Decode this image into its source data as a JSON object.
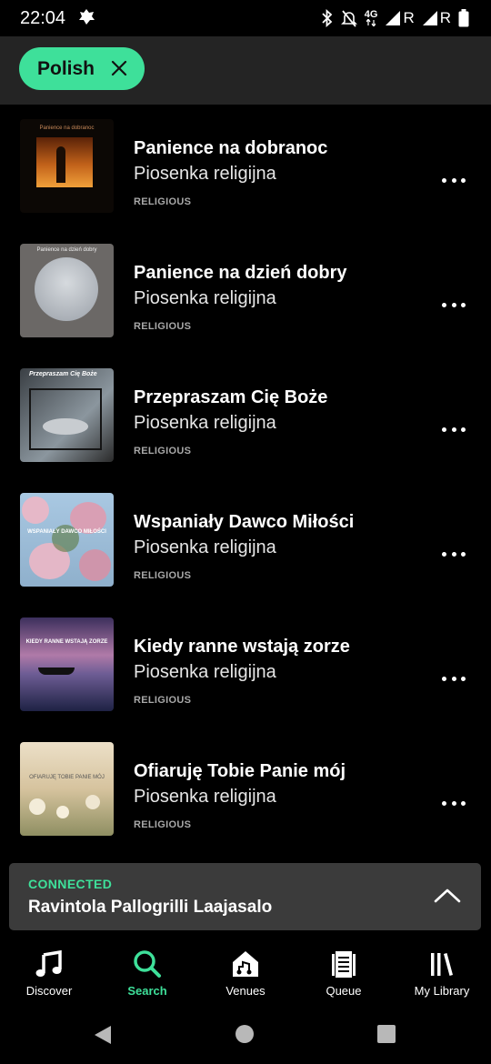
{
  "status_bar": {
    "time": "22:04",
    "network_label": "4G",
    "roaming_1": "R",
    "roaming_2": "R",
    "icons": [
      "notification-app-icon",
      "bluetooth-icon",
      "mute-icon",
      "signal-icon",
      "signal-icon",
      "battery-icon"
    ]
  },
  "filter": {
    "chip_label": "Polish",
    "chip_close_icon": "close-icon"
  },
  "songs": [
    {
      "title": "Panience na dobranoc",
      "artist": "Piosenka religijna",
      "genre": "RELIGIOUS",
      "cover_caption": "Panience na dobranoc",
      "cover_colors": [
        "#1a0d05",
        "#c2621a",
        "#f0a03a"
      ]
    },
    {
      "title": "Panience na dzień dobry",
      "artist": "Piosenka religijna",
      "genre": "RELIGIOUS",
      "cover_caption": "Panience na dzień dobry",
      "cover_colors": [
        "#5e5a58",
        "#b5b8bd",
        "#6b6866"
      ]
    },
    {
      "title": "Przepraszam Cię Boże",
      "artist": "Piosenka religijna",
      "genre": "RELIGIOUS",
      "cover_caption": "Przepraszam Cię Boże",
      "cover_colors": [
        "#1c1c1c",
        "#7b858c",
        "#2e2e2e"
      ]
    },
    {
      "title": "Wspaniały Dawco Miłości",
      "artist": "Piosenka religijna",
      "genre": "RELIGIOUS",
      "cover_caption": "WSPANIAŁY DAWCO MIŁOŚCI",
      "cover_colors": [
        "#d9b7c4",
        "#9fc1dd",
        "#5b7a3f"
      ]
    },
    {
      "title": "Kiedy ranne wstają zorze",
      "artist": "Piosenka religijna",
      "genre": "RELIGIOUS",
      "cover_caption": "KIEDY RANNE WSTAJĄ ZORZE",
      "cover_colors": [
        "#4a3a6e",
        "#9a6aa0",
        "#24284a"
      ]
    },
    {
      "title": "Ofiaruję Tobie Panie mój",
      "artist": "Piosenka religijna",
      "genre": "RELIGIOUS",
      "cover_caption": "OFIARUJĘ TOBIE PANIE MÓJ",
      "cover_colors": [
        "#e8d9bf",
        "#c9b58f",
        "#8a8a5a"
      ]
    }
  ],
  "connected": {
    "label": "CONNECTED",
    "venue": "Ravintola Pallogrilli Laajasalo",
    "toggle_icon": "chevron-up-icon"
  },
  "bottom_nav": [
    {
      "label": "Discover",
      "icon": "music-note-icon",
      "active": false
    },
    {
      "label": "Search",
      "icon": "search-icon",
      "active": true
    },
    {
      "label": "Venues",
      "icon": "venue-house-icon",
      "active": false
    },
    {
      "label": "Queue",
      "icon": "queue-list-icon",
      "active": false
    },
    {
      "label": "My Library",
      "icon": "library-icon",
      "active": false
    }
  ],
  "colors": {
    "accent": "#3ee09a",
    "background": "#000000",
    "header_bg": "#242424",
    "connected_bg": "#3b3b3b",
    "secondary_text": "#a8a8a8"
  }
}
